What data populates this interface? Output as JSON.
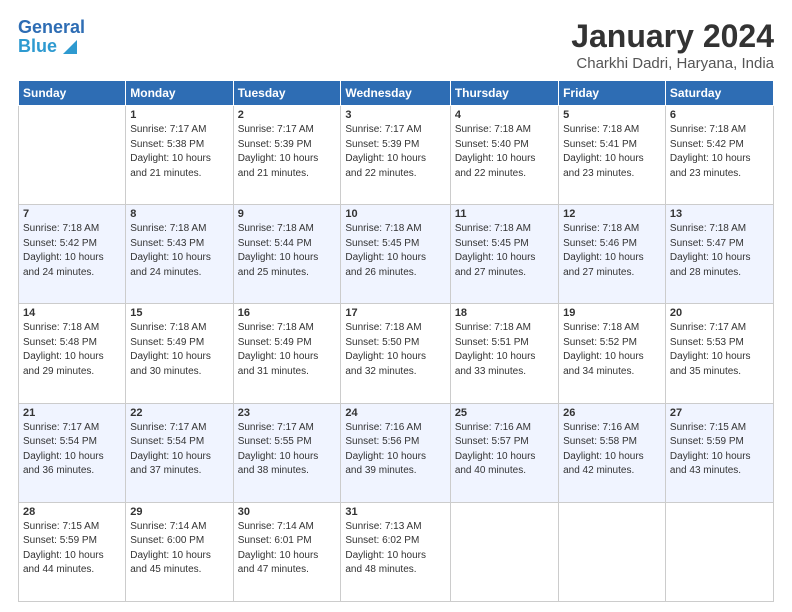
{
  "header": {
    "logo_line1": "General",
    "logo_line2": "Blue",
    "title": "January 2024",
    "subtitle": "Charkhi Dadri, Haryana, India"
  },
  "days_of_week": [
    "Sunday",
    "Monday",
    "Tuesday",
    "Wednesday",
    "Thursday",
    "Friday",
    "Saturday"
  ],
  "weeks": [
    [
      {
        "day": "",
        "info": ""
      },
      {
        "day": "1",
        "info": "Sunrise: 7:17 AM\nSunset: 5:38 PM\nDaylight: 10 hours\nand 21 minutes."
      },
      {
        "day": "2",
        "info": "Sunrise: 7:17 AM\nSunset: 5:39 PM\nDaylight: 10 hours\nand 21 minutes."
      },
      {
        "day": "3",
        "info": "Sunrise: 7:17 AM\nSunset: 5:39 PM\nDaylight: 10 hours\nand 22 minutes."
      },
      {
        "day": "4",
        "info": "Sunrise: 7:18 AM\nSunset: 5:40 PM\nDaylight: 10 hours\nand 22 minutes."
      },
      {
        "day": "5",
        "info": "Sunrise: 7:18 AM\nSunset: 5:41 PM\nDaylight: 10 hours\nand 23 minutes."
      },
      {
        "day": "6",
        "info": "Sunrise: 7:18 AM\nSunset: 5:42 PM\nDaylight: 10 hours\nand 23 minutes."
      }
    ],
    [
      {
        "day": "7",
        "info": "Sunrise: 7:18 AM\nSunset: 5:42 PM\nDaylight: 10 hours\nand 24 minutes."
      },
      {
        "day": "8",
        "info": "Sunrise: 7:18 AM\nSunset: 5:43 PM\nDaylight: 10 hours\nand 24 minutes."
      },
      {
        "day": "9",
        "info": "Sunrise: 7:18 AM\nSunset: 5:44 PM\nDaylight: 10 hours\nand 25 minutes."
      },
      {
        "day": "10",
        "info": "Sunrise: 7:18 AM\nSunset: 5:45 PM\nDaylight: 10 hours\nand 26 minutes."
      },
      {
        "day": "11",
        "info": "Sunrise: 7:18 AM\nSunset: 5:45 PM\nDaylight: 10 hours\nand 27 minutes."
      },
      {
        "day": "12",
        "info": "Sunrise: 7:18 AM\nSunset: 5:46 PM\nDaylight: 10 hours\nand 27 minutes."
      },
      {
        "day": "13",
        "info": "Sunrise: 7:18 AM\nSunset: 5:47 PM\nDaylight: 10 hours\nand 28 minutes."
      }
    ],
    [
      {
        "day": "14",
        "info": "Sunrise: 7:18 AM\nSunset: 5:48 PM\nDaylight: 10 hours\nand 29 minutes."
      },
      {
        "day": "15",
        "info": "Sunrise: 7:18 AM\nSunset: 5:49 PM\nDaylight: 10 hours\nand 30 minutes."
      },
      {
        "day": "16",
        "info": "Sunrise: 7:18 AM\nSunset: 5:49 PM\nDaylight: 10 hours\nand 31 minutes."
      },
      {
        "day": "17",
        "info": "Sunrise: 7:18 AM\nSunset: 5:50 PM\nDaylight: 10 hours\nand 32 minutes."
      },
      {
        "day": "18",
        "info": "Sunrise: 7:18 AM\nSunset: 5:51 PM\nDaylight: 10 hours\nand 33 minutes."
      },
      {
        "day": "19",
        "info": "Sunrise: 7:18 AM\nSunset: 5:52 PM\nDaylight: 10 hours\nand 34 minutes."
      },
      {
        "day": "20",
        "info": "Sunrise: 7:17 AM\nSunset: 5:53 PM\nDaylight: 10 hours\nand 35 minutes."
      }
    ],
    [
      {
        "day": "21",
        "info": "Sunrise: 7:17 AM\nSunset: 5:54 PM\nDaylight: 10 hours\nand 36 minutes."
      },
      {
        "day": "22",
        "info": "Sunrise: 7:17 AM\nSunset: 5:54 PM\nDaylight: 10 hours\nand 37 minutes."
      },
      {
        "day": "23",
        "info": "Sunrise: 7:17 AM\nSunset: 5:55 PM\nDaylight: 10 hours\nand 38 minutes."
      },
      {
        "day": "24",
        "info": "Sunrise: 7:16 AM\nSunset: 5:56 PM\nDaylight: 10 hours\nand 39 minutes."
      },
      {
        "day": "25",
        "info": "Sunrise: 7:16 AM\nSunset: 5:57 PM\nDaylight: 10 hours\nand 40 minutes."
      },
      {
        "day": "26",
        "info": "Sunrise: 7:16 AM\nSunset: 5:58 PM\nDaylight: 10 hours\nand 42 minutes."
      },
      {
        "day": "27",
        "info": "Sunrise: 7:15 AM\nSunset: 5:59 PM\nDaylight: 10 hours\nand 43 minutes."
      }
    ],
    [
      {
        "day": "28",
        "info": "Sunrise: 7:15 AM\nSunset: 5:59 PM\nDaylight: 10 hours\nand 44 minutes."
      },
      {
        "day": "29",
        "info": "Sunrise: 7:14 AM\nSunset: 6:00 PM\nDaylight: 10 hours\nand 45 minutes."
      },
      {
        "day": "30",
        "info": "Sunrise: 7:14 AM\nSunset: 6:01 PM\nDaylight: 10 hours\nand 47 minutes."
      },
      {
        "day": "31",
        "info": "Sunrise: 7:13 AM\nSunset: 6:02 PM\nDaylight: 10 hours\nand 48 minutes."
      },
      {
        "day": "",
        "info": ""
      },
      {
        "day": "",
        "info": ""
      },
      {
        "day": "",
        "info": ""
      }
    ]
  ]
}
